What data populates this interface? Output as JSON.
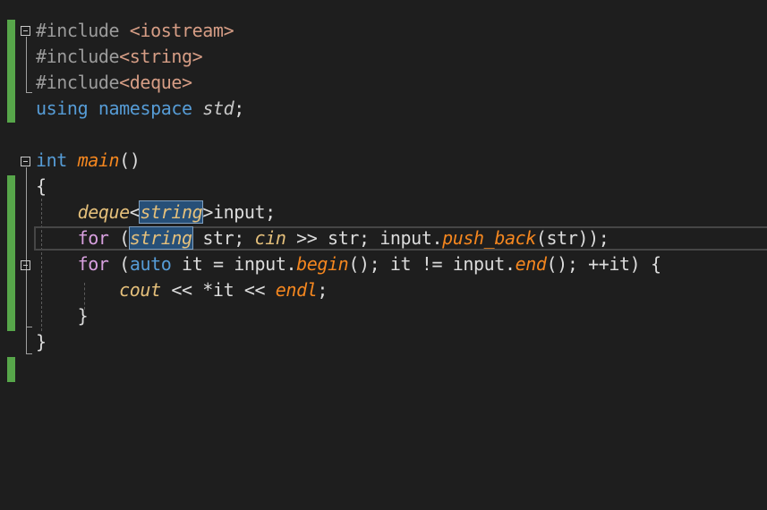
{
  "code": {
    "l1_directive": "#include",
    "l1_header": "<iostream>",
    "l2_directive": "#include",
    "l2_header": "<string>",
    "l3_directive": "#include",
    "l3_header": "<deque>",
    "l4_using": "using",
    "l4_namespace": "namespace",
    "l4_std": "std",
    "l4_semi": ";",
    "l6_int": "int",
    "l6_main": "main",
    "l6_parens": "()",
    "l7_brace": "{",
    "l8_deque": "deque",
    "l8_lt": "<",
    "l8_string": "string",
    "l8_gt": ">",
    "l8_rest": "input;",
    "l9_for": "for",
    "l9_paren": "(",
    "l9_string": "string",
    "l9_mid": " str; ",
    "l9_cin": "cin",
    "l9_mid2": " >> str; input.",
    "l9_push": "push_back",
    "l9_end": "(str));",
    "l10_for": "for",
    "l10_paren": "(",
    "l10_auto": "auto",
    "l10_mid": " it = input.",
    "l10_begin": "begin",
    "l10_mid2": "(); it != input.",
    "l10_endfn": "end",
    "l10_tail": "(); ++it) {",
    "l11_cout": "cout",
    "l11_mid": " << *it << ",
    "l11_endl": "endl",
    "l11_semi": ";",
    "l12_brace": "}",
    "l13_brace": "}"
  },
  "colors": {
    "background": "#1e1e1e",
    "keyword": "#569cd6",
    "control": "#d8a0df",
    "string": "#d69d85",
    "function": "#f5871f",
    "type": "#e5c07b",
    "change_marker": "#57a64a"
  }
}
